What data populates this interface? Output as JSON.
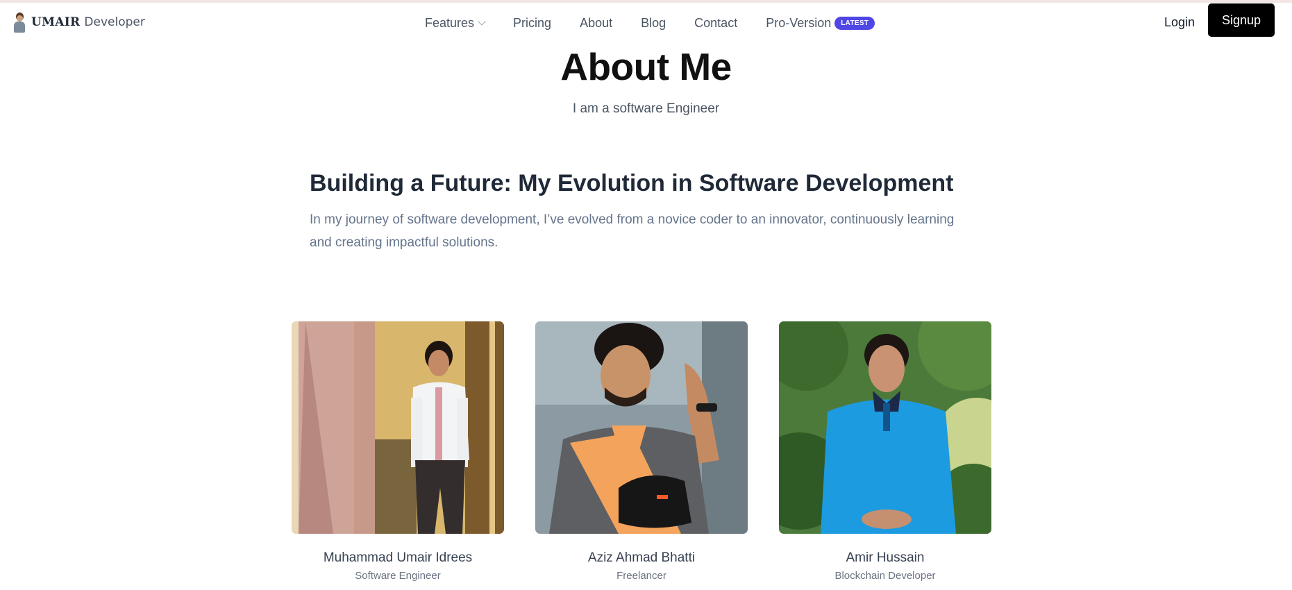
{
  "header": {
    "logo_strong": "UMAIR",
    "logo_light": "Developer",
    "nav": [
      {
        "label": "Features"
      },
      {
        "label": "Pricing"
      },
      {
        "label": "About"
      },
      {
        "label": "Blog"
      },
      {
        "label": "Contact"
      },
      {
        "label": "Pro-Version",
        "badge": "LATEST"
      }
    ],
    "login_label": "Login",
    "signup_label": "Signup"
  },
  "hero": {
    "title": "About Me",
    "subtitle": "I am a software Engineer"
  },
  "section": {
    "title": "Building a Future: My Evolution in Software Development",
    "body": "In my journey of software development, I’ve evolved from a novice coder to an innovator, continuously learning and creating impactful solutions."
  },
  "team": [
    {
      "name": "Muhammad Umair Idrees",
      "role": "Software Engineer"
    },
    {
      "name": "Aziz Ahmad Bhatti",
      "role": "Freelancer"
    },
    {
      "name": "Amir Hussain",
      "role": "Blockchain Developer"
    }
  ],
  "colors": {
    "accent_badge": "#5046e5",
    "signup_bg": "#000000"
  }
}
